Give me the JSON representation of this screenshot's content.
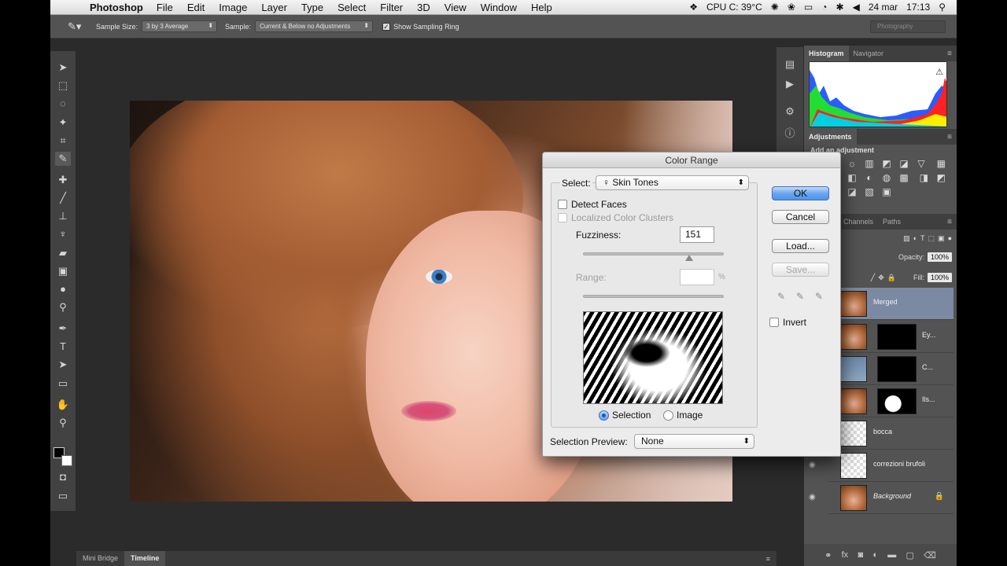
{
  "menubar": {
    "app": "Photoshop",
    "items": [
      "File",
      "Edit",
      "Image",
      "Layer",
      "Type",
      "Select",
      "Filter",
      "3D",
      "View",
      "Window",
      "Help"
    ],
    "status": {
      "cpu": "CPU C: 39°C",
      "date": "24 mar",
      "time": "17:13"
    }
  },
  "options": {
    "sample_size_label": "Sample Size:",
    "sample_size_value": "3 by 3 Average",
    "sample_label": "Sample:",
    "sample_value": "Current & Below no Adjustments",
    "show_ring_label": "Show Sampling Ring",
    "workspace": "Photography"
  },
  "panels": {
    "histogram_tab": "Histogram",
    "navigator_tab": "Navigator",
    "adjustments_tab": "Adjustments",
    "add_adjustment": "Add an adjustment",
    "channels_tab": "Channels",
    "paths_tab": "Paths",
    "opacity_label": "Opacity:",
    "opacity_value": "100%",
    "fill_label": "Fill:",
    "fill_value": "100%",
    "layers": [
      {
        "name": "Merged"
      },
      {
        "name": "Ey..."
      },
      {
        "name": "C..."
      },
      {
        "name": "Ils..."
      },
      {
        "name": "bocca"
      },
      {
        "name": "correzioni brufoli"
      },
      {
        "name": "Background"
      }
    ]
  },
  "bottom_tabs": [
    "Mini Bridge",
    "Timeline"
  ],
  "dialog": {
    "title": "Color Range",
    "select_label": "Select:",
    "select_value": "Skin Tones",
    "detect_faces": "Detect Faces",
    "localized": "Localized Color Clusters",
    "fuzziness_label": "Fuzziness:",
    "fuzziness_value": "151",
    "range_label": "Range:",
    "range_value": "",
    "percent": "%",
    "selection_radio": "Selection",
    "image_radio": "Image",
    "preview_label": "Selection Preview:",
    "preview_value": "None",
    "ok": "OK",
    "cancel": "Cancel",
    "load": "Load...",
    "save": "Save...",
    "invert": "Invert"
  }
}
